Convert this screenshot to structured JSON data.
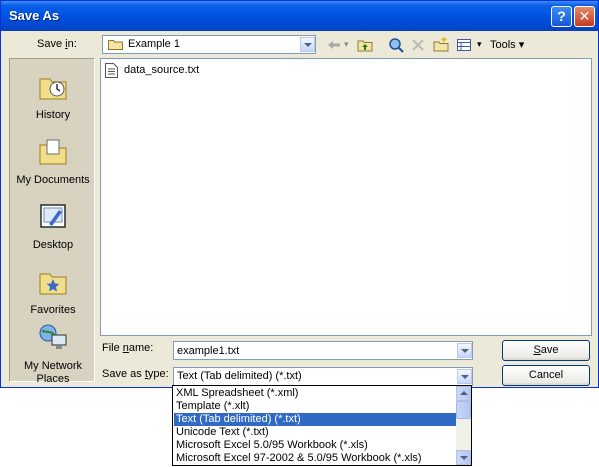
{
  "window": {
    "title": "Save As",
    "help_glyph": "?",
    "close_glyph": "✕"
  },
  "toolbar": {
    "save_in_label_pre": "Save ",
    "save_in_label_key": "i",
    "save_in_label_post": "n:",
    "save_in_value": "Example 1",
    "tools_label": "Tools",
    "tools_caret": "▾",
    "icons": [
      "back-arrow-icon",
      "up-one-level-icon",
      "search-the-web-icon",
      "delete-icon",
      "create-new-folder-icon",
      "views-icon"
    ]
  },
  "places": [
    {
      "label": "History",
      "icon": "history-icon"
    },
    {
      "label": "My Documents",
      "icon": "my-documents-icon"
    },
    {
      "label": "Desktop",
      "icon": "desktop-icon"
    },
    {
      "label": "Favorites",
      "icon": "favorites-icon"
    },
    {
      "label_line1": "My Network",
      "label_line2": "Places",
      "icon": "my-network-places-icon"
    }
  ],
  "files": [
    {
      "name": "data_source.txt",
      "icon": "text-file-icon"
    }
  ],
  "form": {
    "file_name_label_pre": "File ",
    "file_name_label_key": "n",
    "file_name_label_post": "ame:",
    "file_name_value": "example1.txt",
    "save_as_type_label_pre": "Save as ",
    "save_as_type_label_key": "t",
    "save_as_type_label_post": "ype:",
    "save_as_type_value": "Text (Tab delimited) (*.txt)",
    "save_button_pre": "",
    "save_button_key": "S",
    "save_button_post": "ave",
    "cancel_button": "Cancel"
  },
  "type_options": [
    "XML Spreadsheet (*.xml)",
    "Template (*.xlt)",
    "Text (Tab delimited) (*.txt)",
    "Unicode Text (*.txt)",
    "Microsoft Excel 5.0/95 Workbook (*.xls)",
    "Microsoft Excel 97-2002 & 5.0/95 Workbook (*.xls)"
  ],
  "selected_type_index": 2,
  "colors": {
    "title_bar": "#0054e3",
    "dialog_bg": "#ece9d8",
    "selection": "#316ac5"
  }
}
